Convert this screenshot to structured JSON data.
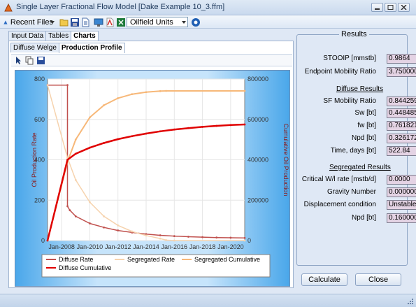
{
  "window": {
    "title": "Single Layer Fractional Flow Model [Dake Example 10_3.ffm]"
  },
  "toolbar": {
    "recent_files": "Recent Files",
    "units_selected": "Oilfield Units",
    "icons": [
      "open-folder-icon",
      "save-icon",
      "document-icon",
      "monitor-icon",
      "pdf-icon",
      "excel-icon",
      "help-icon"
    ]
  },
  "tabs": {
    "main": [
      "Input Data",
      "Tables",
      "Charts"
    ],
    "sub": [
      "Diffuse Welge",
      "Production Profile"
    ]
  },
  "results": {
    "legend": "Results",
    "stooip_label": "STOOIP [mmstb]",
    "stooip_value": "0.9864",
    "endpoint_label": "Endpoint Mobility Ratio",
    "endpoint_value": "3.750000",
    "diffuse_head": "Diffuse Results",
    "sf_label": "SF Mobility Ratio",
    "sf_value": "0.844259",
    "sw_label": "Sw [bt]",
    "sw_value": "0.448485",
    "fw_label": "fw [bt]",
    "fw_value": "0.761821",
    "npd_label": "Npd [bt]",
    "npd_value": "0.326172",
    "time_label": "Time, days [bt]",
    "time_value": "522.84",
    "segregated_head": "Segregated Results",
    "critical_label": "Critical W/l rate [mstb/d]",
    "critical_value": "0.0000",
    "gravity_label": "Gravity Number",
    "gravity_value": "0.000000",
    "displacement_label": "Displacement condition",
    "displacement_value": "Unstable",
    "npd2_label": "Npd [bt]",
    "npd2_value": "0.160000"
  },
  "buttons": {
    "calculate": "Calculate",
    "close": "Close"
  },
  "colors": {
    "diffuse_rate": "#c0504d",
    "diffuse_cumulative": "#e00000",
    "segregated_rate": "#f6d3ae",
    "segregated_cumulative": "#f7b879"
  },
  "chart_data": {
    "type": "line",
    "ylabel": "Oil Production Rate",
    "y2label": "Cumulative Oil Production",
    "ylim": [
      0,
      800
    ],
    "yticks": [
      "0",
      "200",
      "400",
      "600",
      "800"
    ],
    "y2lim": [
      0,
      800000
    ],
    "y2ticks": [
      "0",
      "200000",
      "400000",
      "600000",
      "800000"
    ],
    "xticks": [
      "Jan-2008",
      "Jan-2010",
      "Jan-2012",
      "Jan-2014",
      "Jan-2016",
      "Jan-2018",
      "Jan-2020"
    ],
    "xlim": [
      "Jan-2007",
      "Jan-2021"
    ],
    "grid": true,
    "legend_position": "bottom",
    "series": [
      {
        "name": "Diffuse Rate",
        "axis": "left",
        "x": [
          "Jan-2007",
          "Jun-2008",
          "Jun-2008",
          "Aug-2008",
          "Jan-2009",
          "Jan-2010",
          "Jan-2011",
          "Jan-2012",
          "Jan-2013",
          "Jan-2014",
          "Jan-2015",
          "Jan-2016",
          "Jan-2017",
          "Jan-2018",
          "Jan-2019",
          "Jan-2020",
          "Jan-2021"
        ],
        "values": [
          770,
          770,
          170,
          150,
          120,
          85,
          65,
          50,
          40,
          32,
          26,
          22,
          19,
          17,
          15,
          14,
          13
        ]
      },
      {
        "name": "Segregated Rate",
        "axis": "left",
        "x": [
          "Jan-2007",
          "Jun-2008",
          "Jan-2009",
          "Jan-2010",
          "Jan-2011",
          "Jan-2012",
          "Jan-2013",
          "Jan-2014",
          "Jan-2015",
          "Jun-2015",
          "Jan-2016",
          "Jan-2021"
        ],
        "values": [
          770,
          410,
          300,
          190,
          120,
          75,
          45,
          25,
          10,
          2,
          0,
          0
        ]
      },
      {
        "name": "Segregated Cumulative",
        "axis": "right",
        "x": [
          "Jan-2007",
          "Jun-2008",
          "Jan-2009",
          "Jan-2010",
          "Jan-2011",
          "Jan-2012",
          "Jan-2013",
          "Jan-2014",
          "Jan-2015",
          "Jun-2015",
          "Jan-2021"
        ],
        "values": [
          0,
          390000,
          500000,
          610000,
          670000,
          705000,
          725000,
          735000,
          740000,
          741000,
          741000
        ]
      },
      {
        "name": "Diffuse Cumulative",
        "axis": "right",
        "x": [
          "Jan-2007",
          "Jun-2008",
          "Jan-2009",
          "Jan-2010",
          "Jan-2011",
          "Jan-2012",
          "Jan-2013",
          "Jan-2014",
          "Jan-2015",
          "Jan-2016",
          "Jan-2017",
          "Jan-2018",
          "Jan-2019",
          "Jan-2020",
          "Jan-2021"
        ],
        "values": [
          0,
          400000,
          430000,
          460000,
          483000,
          502000,
          517000,
          530000,
          541000,
          550000,
          557000,
          563000,
          568000,
          572000,
          575000
        ]
      }
    ]
  }
}
